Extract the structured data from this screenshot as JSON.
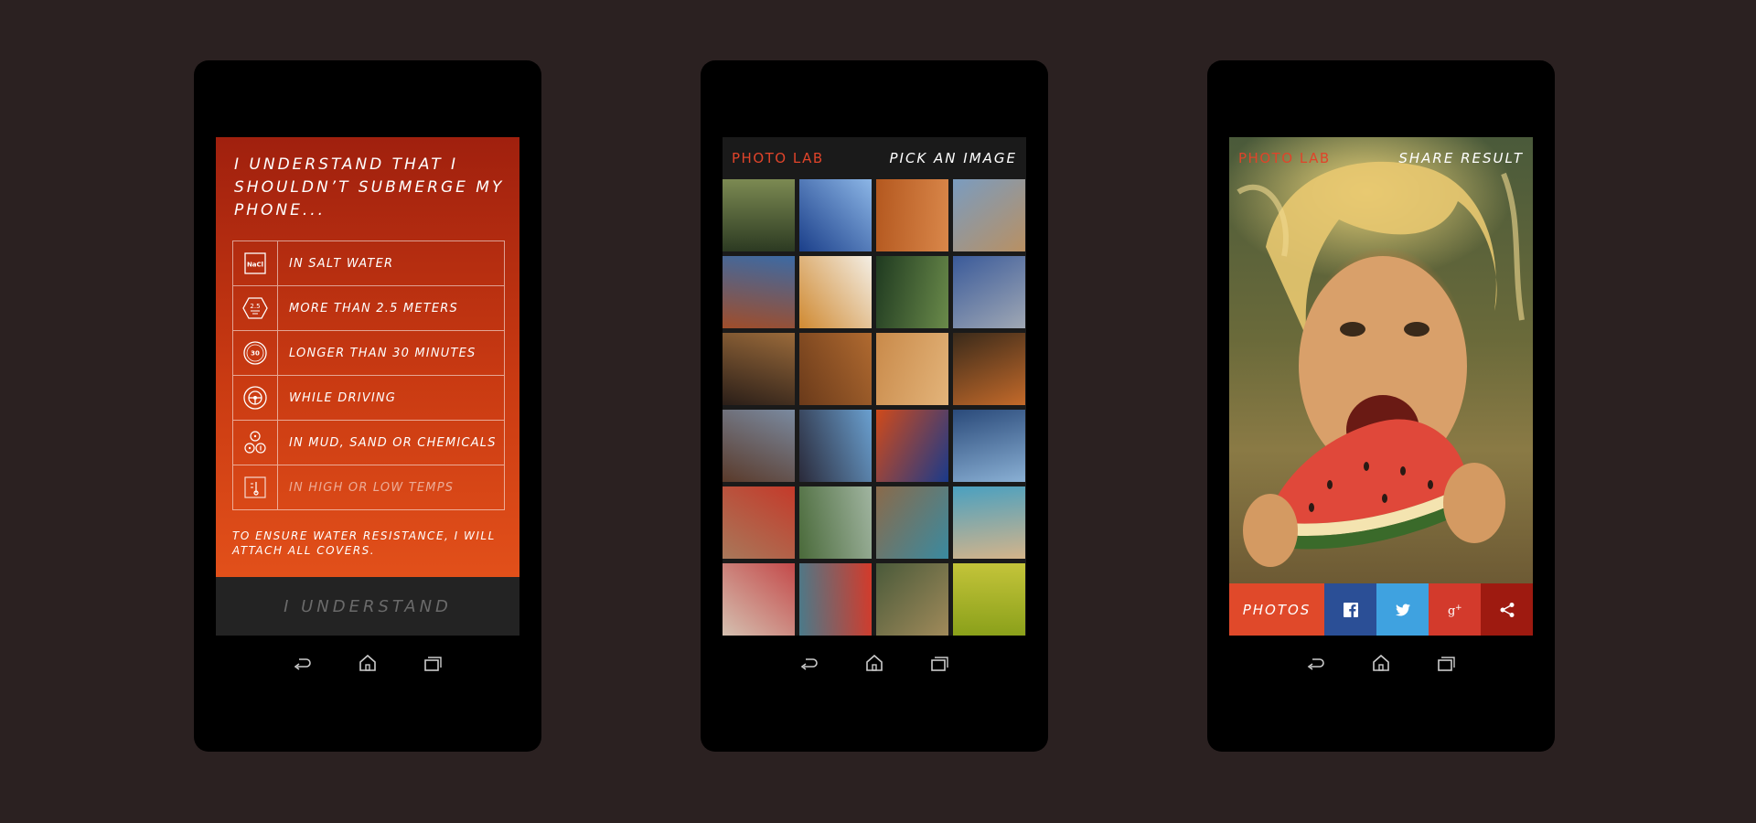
{
  "phone1": {
    "title": "I UNDERSTAND THAT I SHOULDN’T SUBMERGE MY PHONE...",
    "rules": [
      {
        "icon": "nacl-icon",
        "badge": "NaCl",
        "label": "IN SALT WATER"
      },
      {
        "icon": "depth-icon",
        "badge": "2.5",
        "label": "MORE THAN 2.5 METERS"
      },
      {
        "icon": "timer-icon",
        "badge": "30",
        "label": "LONGER THAN 30 MINUTES"
      },
      {
        "icon": "steering-wheel-icon",
        "label": "WHILE DRIVING"
      },
      {
        "icon": "chemicals-icon",
        "label": "IN MUD, SAND OR CHEMICALS"
      },
      {
        "icon": "temperature-icon",
        "label": "IN HIGH OR LOW TEMPS"
      }
    ],
    "footer": "TO ENSURE WATER RESISTANCE, I WILL ATTACH ALL COVERS.",
    "button": "I UNDERSTAND"
  },
  "phone2": {
    "brand": "PHOTO LAB",
    "action": "PICK AN IMAGE",
    "thumbnails": [
      {
        "name": "forest",
        "colors": [
          "#2c3a22",
          "#7c8a52"
        ]
      },
      {
        "name": "glass-building",
        "colors": [
          "#1b3f8a",
          "#8cb6e6"
        ]
      },
      {
        "name": "desert",
        "colors": [
          "#b4581f",
          "#d9874a"
        ]
      },
      {
        "name": "statue-beach",
        "colors": [
          "#7a9cc0",
          "#b99062"
        ]
      },
      {
        "name": "sneakers",
        "colors": [
          "#a04d2a",
          "#3c6aa4"
        ]
      },
      {
        "name": "letter-frame",
        "colors": [
          "#d08a32",
          "#f3eee4"
        ]
      },
      {
        "name": "tree-canopy",
        "colors": [
          "#1f3a20",
          "#6a8a4a"
        ]
      },
      {
        "name": "statue-sky",
        "colors": [
          "#3a5a9a",
          "#a0a8b4"
        ]
      },
      {
        "name": "guitar",
        "colors": [
          "#2a1e18",
          "#9a6a3a"
        ]
      },
      {
        "name": "duck",
        "colors": [
          "#6a3a1a",
          "#b06a30"
        ]
      },
      {
        "name": "child-watermelon",
        "colors": [
          "#c98a4a",
          "#e3b47a"
        ]
      },
      {
        "name": "vintage-car",
        "colors": [
          "#3a2a1a",
          "#c46a2a"
        ]
      },
      {
        "name": "old-building",
        "colors": [
          "#5a3a2a",
          "#7a8aa0"
        ]
      },
      {
        "name": "mother-child",
        "colors": [
          "#2a2a3a",
          "#6aa0d0"
        ]
      },
      {
        "name": "reflection",
        "colors": [
          "#d04a1a",
          "#1a3a8a"
        ]
      },
      {
        "name": "river-city",
        "colors": [
          "#2a4a7a",
          "#8ab0d4"
        ]
      },
      {
        "name": "graffiti",
        "colors": [
          "#a8785a",
          "#c43a2a"
        ]
      },
      {
        "name": "landscape",
        "colors": [
          "#4a6a3a",
          "#a0b4a0"
        ]
      },
      {
        "name": "stone-arch",
        "colors": [
          "#8a6a4a",
          "#3a8aa0"
        ]
      },
      {
        "name": "boat-beach",
        "colors": [
          "#4aa0c0",
          "#d4b48a"
        ]
      },
      {
        "name": "woman-child",
        "colors": [
          "#d4c0b0",
          "#c44a4a"
        ]
      },
      {
        "name": "scooter",
        "colors": [
          "#4a7a8a",
          "#d43a2a"
        ]
      },
      {
        "name": "crowd",
        "colors": [
          "#4a5a3a",
          "#a08a5a"
        ]
      },
      {
        "name": "green-wall",
        "colors": [
          "#8aa01a",
          "#c4c43a"
        ]
      }
    ]
  },
  "phone3": {
    "brand": "PHOTO LAB",
    "action": "SHARE RESULT",
    "photos_label": "PHOTOS",
    "share_buttons": [
      "facebook-icon",
      "twitter-icon",
      "google-plus-icon",
      "share-icon"
    ]
  },
  "navbar": [
    "back-icon",
    "home-icon",
    "recent-apps-icon"
  ]
}
